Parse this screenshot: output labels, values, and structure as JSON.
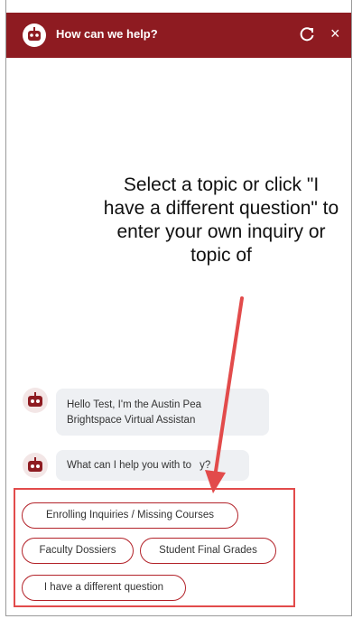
{
  "header": {
    "title": "How can we help?",
    "icons": [
      "bot-icon",
      "refresh-icon",
      "close-icon"
    ],
    "close_glyph": "×"
  },
  "annotation": {
    "text": "Select a topic or click \"I have a different question\" to enter your own inquiry or topic of"
  },
  "messages": [
    {
      "text": "Hello Test, I'm the Austin Pea",
      "text_line2": "Brightspace Virtual Assistan"
    },
    {
      "text": "What can I help you with to",
      "text_tail": "y?"
    }
  ],
  "options": [
    "Enrolling Inquiries / Missing Courses",
    "Faculty Dossiers",
    "Student Final Grades",
    "I have a different question"
  ],
  "colors": {
    "brand": "#8e1b21",
    "annotation_red": "#e24b4b",
    "bubble_bg": "#eef0f3"
  }
}
